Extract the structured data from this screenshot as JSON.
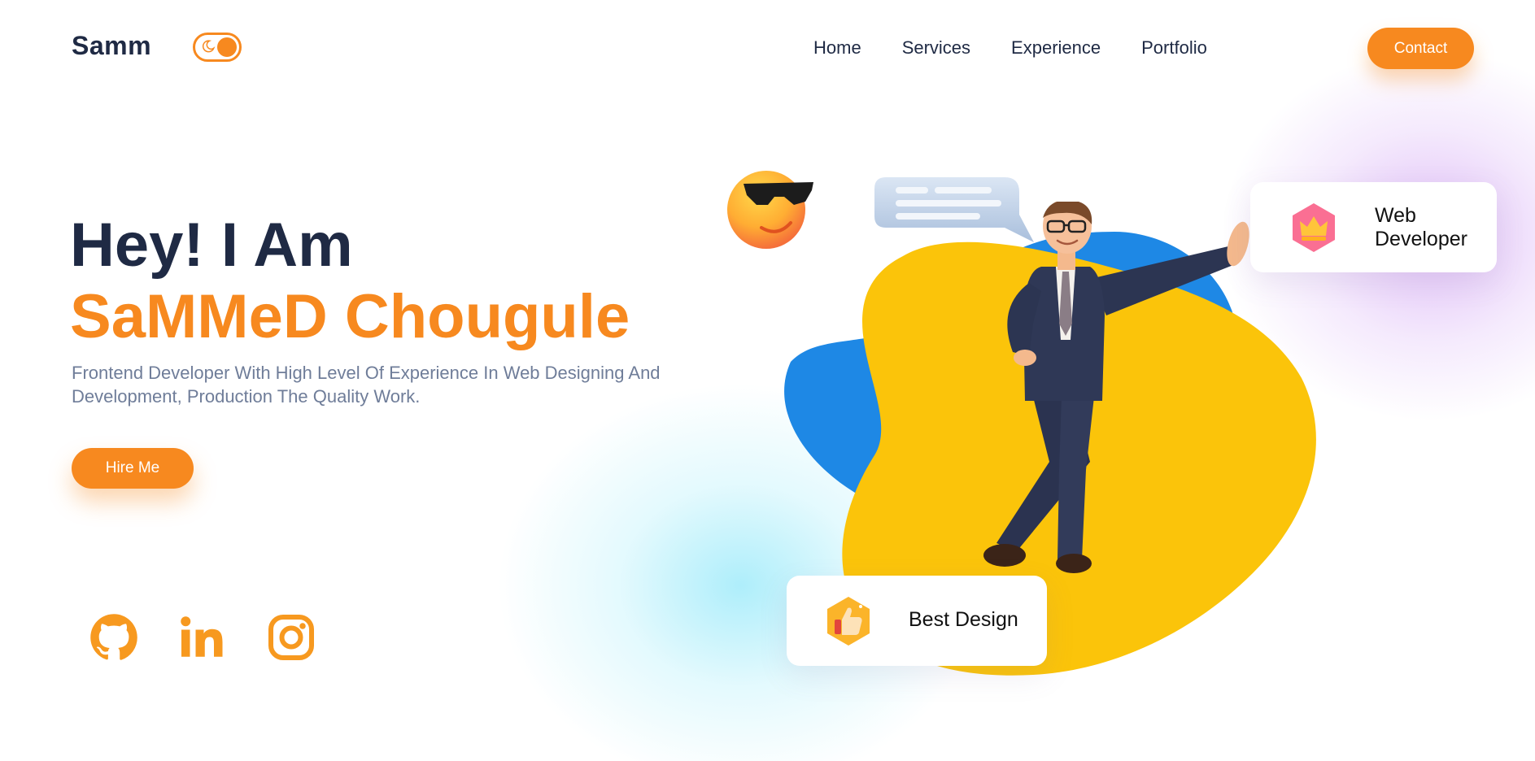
{
  "header": {
    "logo": "Samm",
    "nav": [
      "Home",
      "Services",
      "Experience",
      "Portfolio"
    ],
    "contact_label": "Contact"
  },
  "hero": {
    "greeting": "Hey! I Am",
    "name": "SaMMeD Chougule",
    "description": "Frontend Developer With High Level Of Experience In Web Designing And Development, Production The Quality Work.",
    "hire_label": "Hire Me"
  },
  "social": [
    "github-icon",
    "linkedin-icon",
    "instagram-icon"
  ],
  "cards": {
    "web_developer": "Web Developer",
    "best_design": "Best Design"
  },
  "colors": {
    "accent": "#f7891f",
    "navy": "#1f2a44",
    "muted": "#6f7d99",
    "yellow": "#fbc40a",
    "blue": "#1e88e5"
  }
}
